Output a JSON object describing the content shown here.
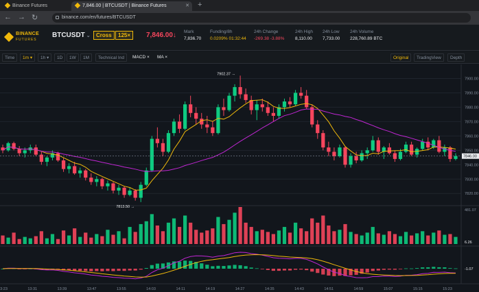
{
  "browser": {
    "tabs": [
      {
        "title": "Binance Futures",
        "active": false
      },
      {
        "title": "7,846.00 | BTCUSDT | Binance Futures",
        "active": true
      }
    ],
    "new_tab": "+",
    "url": "binance.com/en/futures/BTCUSDT",
    "nav": {
      "back": "←",
      "forward": "→",
      "reload": "↻"
    }
  },
  "header": {
    "logo_line1": "BINANCE",
    "logo_line2": "FUTURES",
    "symbol": "BTCUSDT",
    "margin_mode": "Cross",
    "leverage": "125×",
    "last_price": "7,846.00↓",
    "stats": [
      {
        "key": "Mark",
        "value": "7,836.70",
        "color": "normal"
      },
      {
        "key": "Funding/8h",
        "value": "0.0209%  01:32:44",
        "color": "yellow"
      },
      {
        "key": "24h Change",
        "value": "-269.38 -3.88%",
        "color": "red"
      },
      {
        "key": "24h High",
        "value": "8,110.00",
        "color": "normal"
      },
      {
        "key": "24h Low",
        "value": "7,733.00",
        "color": "normal"
      },
      {
        "key": "24h Volume",
        "value": "228,760.89 BTC",
        "color": "normal"
      }
    ]
  },
  "toolbar": {
    "time": "Time",
    "intervals": [
      "1m ▾",
      "1h ▾",
      "1D",
      "1W",
      "1M"
    ],
    "active_interval": "1m ▾",
    "technical": "Technical Ind",
    "indicators": [
      "MACD ×",
      "MA ×"
    ],
    "views": [
      "Original",
      "TradingView",
      "Depth"
    ],
    "active_view": "Original"
  },
  "colors": {
    "up": "#0ecb81",
    "down": "#f6465d",
    "ma_fast": "#f0b90b",
    "ma_slow": "#c026d3",
    "brand": "#f0b90b"
  },
  "chart_data": {
    "type": "candlestick",
    "price_axis": [
      "7900.00",
      "7890.00",
      "7880.00",
      "7870.00",
      "7860.00",
      "7850.00",
      "7840.00",
      "7830.00",
      "7820.00"
    ],
    "current_price_label": "7846.00",
    "high_label": "7902.37 →",
    "low_label": "7813.50 →",
    "volume_axis": [
      "481.07",
      "6.26"
    ],
    "macd_axis": "-1.07",
    "time_axis": [
      "13:23",
      "13:31",
      "13:39",
      "13:47",
      "13:55",
      "14:03",
      "14:11",
      "14:19",
      "14:27",
      "14:35",
      "14:43",
      "14:51",
      "14:59",
      "15:07",
      "15:15",
      "15:23"
    ],
    "candles": [
      [
        7852,
        7854,
        7848,
        7850
      ],
      [
        7850,
        7856,
        7849,
        7855
      ],
      [
        7855,
        7856,
        7850,
        7851
      ],
      [
        7851,
        7853,
        7846,
        7848
      ],
      [
        7848,
        7852,
        7845,
        7850
      ],
      [
        7850,
        7854,
        7848,
        7852
      ],
      [
        7852,
        7854,
        7846,
        7847
      ],
      [
        7847,
        7849,
        7840,
        7842
      ],
      [
        7842,
        7846,
        7839,
        7845
      ],
      [
        7845,
        7850,
        7843,
        7848
      ],
      [
        7848,
        7849,
        7842,
        7843
      ],
      [
        7843,
        7845,
        7835,
        7837
      ],
      [
        7837,
        7841,
        7834,
        7839
      ],
      [
        7839,
        7842,
        7833,
        7834
      ],
      [
        7834,
        7838,
        7831,
        7836
      ],
      [
        7836,
        7837,
        7829,
        7831
      ],
      [
        7831,
        7834,
        7826,
        7828
      ],
      [
        7828,
        7832,
        7825,
        7830
      ],
      [
        7830,
        7831,
        7823,
        7825
      ],
      [
        7825,
        7829,
        7822,
        7827
      ],
      [
        7827,
        7828,
        7820,
        7822
      ],
      [
        7822,
        7826,
        7819,
        7824
      ],
      [
        7824,
        7825,
        7817,
        7819
      ],
      [
        7819,
        7824,
        7818,
        7822
      ],
      [
        7822,
        7823,
        7815,
        7817
      ],
      [
        7817,
        7828,
        7814,
        7826
      ],
      [
        7826,
        7838,
        7825,
        7836
      ],
      [
        7836,
        7860,
        7835,
        7858
      ],
      [
        7858,
        7866,
        7852,
        7855
      ],
      [
        7855,
        7858,
        7846,
        7849
      ],
      [
        7849,
        7864,
        7848,
        7862
      ],
      [
        7862,
        7872,
        7860,
        7870
      ],
      [
        7870,
        7875,
        7862,
        7865
      ],
      [
        7865,
        7884,
        7864,
        7882
      ],
      [
        7882,
        7888,
        7873,
        7876
      ],
      [
        7876,
        7880,
        7868,
        7872
      ],
      [
        7872,
        7876,
        7865,
        7868
      ],
      [
        7868,
        7874,
        7862,
        7866
      ],
      [
        7866,
        7870,
        7860,
        7862
      ],
      [
        7862,
        7882,
        7861,
        7880
      ],
      [
        7880,
        7886,
        7874,
        7878
      ],
      [
        7878,
        7890,
        7877,
        7888
      ],
      [
        7888,
        7896,
        7884,
        7894
      ],
      [
        7894,
        7902,
        7886,
        7889
      ],
      [
        7889,
        7893,
        7883,
        7885
      ],
      [
        7885,
        7888,
        7875,
        7878
      ],
      [
        7878,
        7885,
        7871,
        7882
      ],
      [
        7882,
        7886,
        7877,
        7880
      ],
      [
        7880,
        7884,
        7874,
        7876
      ],
      [
        7876,
        7880,
        7870,
        7874
      ],
      [
        7874,
        7882,
        7872,
        7880
      ],
      [
        7880,
        7886,
        7877,
        7884
      ],
      [
        7884,
        7887,
        7880,
        7882
      ],
      [
        7882,
        7892,
        7881,
        7890
      ],
      [
        7890,
        7894,
        7886,
        7888
      ],
      [
        7888,
        7892,
        7879,
        7880
      ],
      [
        7880,
        7882,
        7866,
        7868
      ],
      [
        7868,
        7871,
        7858,
        7862
      ],
      [
        7862,
        7864,
        7850,
        7852
      ],
      [
        7852,
        7856,
        7846,
        7849
      ],
      [
        7849,
        7852,
        7843,
        7846
      ],
      [
        7846,
        7854,
        7845,
        7852
      ],
      [
        7852,
        7853,
        7838,
        7840
      ],
      [
        7840,
        7848,
        7838,
        7846
      ],
      [
        7846,
        7849,
        7841,
        7843
      ],
      [
        7843,
        7850,
        7842,
        7848
      ],
      [
        7848,
        7852,
        7844,
        7850
      ],
      [
        7850,
        7860,
        7849,
        7857
      ],
      [
        7857,
        7859,
        7847,
        7849
      ],
      [
        7849,
        7853,
        7844,
        7852
      ],
      [
        7852,
        7855,
        7847,
        7848
      ],
      [
        7848,
        7850,
        7842,
        7844
      ],
      [
        7844,
        7851,
        7843,
        7849
      ],
      [
        7849,
        7856,
        7848,
        7854
      ],
      [
        7854,
        7856,
        7846,
        7847
      ],
      [
        7847,
        7852,
        7845,
        7851
      ],
      [
        7851,
        7858,
        7850,
        7856
      ],
      [
        7856,
        7859,
        7850,
        7852
      ],
      [
        7852,
        7858,
        7851,
        7857
      ],
      [
        7857,
        7860,
        7848,
        7849
      ],
      [
        7849,
        7854,
        7846,
        7852
      ],
      [
        7852,
        7853,
        7842,
        7844
      ],
      [
        7844,
        7848,
        7843,
        7846
      ]
    ],
    "volume": [
      60,
      45,
      80,
      35,
      50,
      40,
      55,
      90,
      40,
      70,
      35,
      95,
      60,
      110,
      50,
      80,
      45,
      70,
      55,
      100,
      65,
      90,
      40,
      120,
      85,
      140,
      160,
      210,
      130,
      90,
      150,
      180,
      120,
      200,
      150,
      100,
      80,
      95,
      110,
      190,
      140,
      170,
      220,
      260,
      150,
      120,
      90,
      100,
      85,
      70,
      95,
      120,
      80,
      150,
      110,
      90,
      180,
      150,
      200,
      130,
      90,
      100,
      140,
      85,
      70,
      60,
      80,
      120,
      75,
      65,
      90,
      70,
      55,
      85,
      60,
      75,
      90,
      60,
      80,
      95,
      65,
      70,
      50
    ]
  }
}
